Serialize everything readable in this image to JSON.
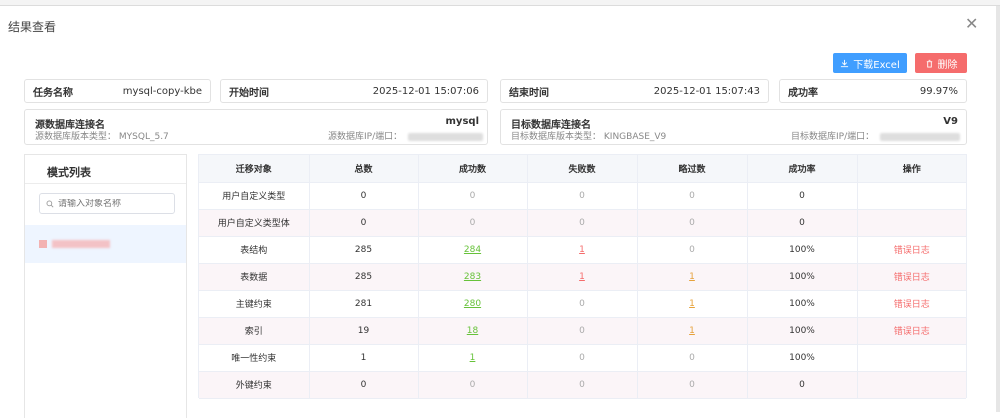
{
  "dialog": {
    "title": "结果查看",
    "close_icon": "close-icon",
    "buttons": {
      "download_label": "下载Excel",
      "delete_label": "删除"
    }
  },
  "summary": {
    "task_label": "任务名称",
    "task_value": "mysql-copy-kbe",
    "start_label": "开始时间",
    "start_value": "2025-12-01 15:07:06",
    "end_label": "结束时间",
    "end_value": "2025-12-01 15:07:43",
    "rate_label": "成功率",
    "rate_value": "99.97%"
  },
  "source": {
    "label": "源数据库连接名",
    "value": "mysql",
    "type_label": "源数据库版本类型：",
    "type_value": "MYSQL_5.7",
    "ip_label": "源数据库IP/端口："
  },
  "target": {
    "label": "目标数据库连接名",
    "value": "V9",
    "type_label": "目标数据库版本类型：",
    "type_value": "KINGBASE_V9",
    "ip_label": "目标数据库IP/端口："
  },
  "sidebar": {
    "title": "模式列表",
    "search_placeholder": "请输入对象名称"
  },
  "table": {
    "headers": [
      "迁移对象",
      "总数",
      "成功数",
      "失败数",
      "略过数",
      "成功率",
      "操作"
    ],
    "rows": [
      {
        "object": "用户自定义类型",
        "total": "0",
        "success": "0",
        "fail": "0",
        "skip": "0",
        "rate": "0",
        "action": ""
      },
      {
        "object": "用户自定义类型体",
        "total": "0",
        "success": "0",
        "fail": "0",
        "skip": "0",
        "rate": "0",
        "action": ""
      },
      {
        "object": "表结构",
        "total": "285",
        "success": "284",
        "fail": "1",
        "skip": "0",
        "rate": "100%",
        "action": "错误日志"
      },
      {
        "object": "表数据",
        "total": "285",
        "success": "283",
        "fail": "1",
        "skip": "1",
        "rate": "100%",
        "action": "错误日志"
      },
      {
        "object": "主键约束",
        "total": "281",
        "success": "280",
        "fail": "0",
        "skip": "1",
        "rate": "100%",
        "action": "错误日志"
      },
      {
        "object": "索引",
        "total": "19",
        "success": "18",
        "fail": "0",
        "skip": "1",
        "rate": "100%",
        "action": "错误日志"
      },
      {
        "object": "唯一性约束",
        "total": "1",
        "success": "1",
        "fail": "0",
        "skip": "0",
        "rate": "100%",
        "action": ""
      },
      {
        "object": "外键约束",
        "total": "0",
        "success": "0",
        "fail": "0",
        "skip": "0",
        "rate": "0",
        "action": ""
      }
    ]
  },
  "colors": {
    "primary": "#409eff",
    "danger": "#f56c6c",
    "success": "#67c23a",
    "warning": "#e6a23c"
  }
}
